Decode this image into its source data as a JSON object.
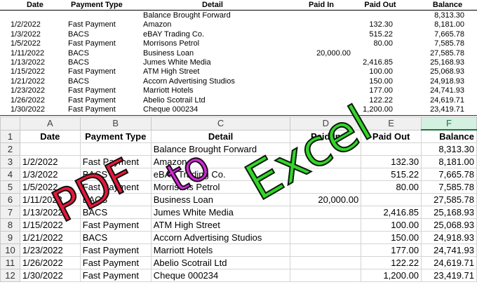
{
  "overlay": {
    "pdf": "PDF",
    "to": "to",
    "excel": "Excel"
  },
  "pdf": {
    "headers": {
      "date": "Date",
      "type": "Payment Type",
      "detail": "Detail",
      "paid_in": "Paid In",
      "paid_out": "Paid Out",
      "balance": "Balance"
    },
    "rows": [
      {
        "date": "",
        "type": "",
        "detail": "Balance Brought Forward",
        "paid_in": "",
        "paid_out": "",
        "balance": "8,313.30"
      },
      {
        "date": "1/2/2022",
        "type": "Fast Payment",
        "detail": "Amazon",
        "paid_in": "",
        "paid_out": "132.30",
        "balance": "8,181.00"
      },
      {
        "date": "1/3/2022",
        "type": "BACS",
        "detail": "eBAY Trading Co.",
        "paid_in": "",
        "paid_out": "515.22",
        "balance": "7,665.78"
      },
      {
        "date": "1/5/2022",
        "type": "Fast Payment",
        "detail": "Morrisons Petrol",
        "paid_in": "",
        "paid_out": "80.00",
        "balance": "7,585.78"
      },
      {
        "date": "1/11/2022",
        "type": "BACS",
        "detail": "Business Loan",
        "paid_in": "20,000.00",
        "paid_out": "",
        "balance": "27,585.78"
      },
      {
        "date": "1/13/2022",
        "type": "BACS",
        "detail": "Jumes White Media",
        "paid_in": "",
        "paid_out": "2,416.85",
        "balance": "25,168.93"
      },
      {
        "date": "1/15/2022",
        "type": "Fast Payment",
        "detail": "ATM High Street",
        "paid_in": "",
        "paid_out": "100.00",
        "balance": "25,068.93"
      },
      {
        "date": "1/21/2022",
        "type": "BACS",
        "detail": "Accorn Advertising Studios",
        "paid_in": "",
        "paid_out": "150.00",
        "balance": "24,918.93"
      },
      {
        "date": "1/23/2022",
        "type": "Fast Payment",
        "detail": "Marriott Hotels",
        "paid_in": "",
        "paid_out": "177.00",
        "balance": "24,741.93"
      },
      {
        "date": "1/26/2022",
        "type": "Fast Payment",
        "detail": "Abelio Scotrail Ltd",
        "paid_in": "",
        "paid_out": "122.22",
        "balance": "24,619.71"
      },
      {
        "date": "1/30/2022",
        "type": "Fast Payment",
        "detail": "Cheque 000234",
        "paid_in": "",
        "paid_out": "1,200.00",
        "balance": "23,419.71"
      }
    ]
  },
  "excel": {
    "column_letters": [
      "A",
      "B",
      "C",
      "D",
      "E",
      "F"
    ],
    "selected_column": "F",
    "headers": [
      "Date",
      "Payment Type",
      "Detail",
      "Paid In",
      "Paid Out",
      "Balance"
    ],
    "rows": [
      {
        "n": "2",
        "date": "",
        "type": "",
        "detail": "Balance Brought Forward",
        "paid_in": "",
        "paid_out": "",
        "balance": "8,313.30"
      },
      {
        "n": "3",
        "date": "1/2/2022",
        "type": "Fast Payment",
        "detail": "Amazon",
        "paid_in": "",
        "paid_out": "132.30",
        "balance": "8,181.00"
      },
      {
        "n": "4",
        "date": "1/3/2022",
        "type": "BACS",
        "detail": "eBAY Trading Co.",
        "paid_in": "",
        "paid_out": "515.22",
        "balance": "7,665.78"
      },
      {
        "n": "5",
        "date": "1/5/2022",
        "type": "Fast Payment",
        "detail": "Morrisons Petrol",
        "paid_in": "",
        "paid_out": "80.00",
        "balance": "7,585.78"
      },
      {
        "n": "6",
        "date": "1/11/2022",
        "type": "BACS",
        "detail": "Business Loan",
        "paid_in": "20,000.00",
        "paid_out": "",
        "balance": "27,585.78"
      },
      {
        "n": "7",
        "date": "1/13/2022",
        "type": "BACS",
        "detail": "Jumes White Media",
        "paid_in": "",
        "paid_out": "2,416.85",
        "balance": "25,168.93"
      },
      {
        "n": "8",
        "date": "1/15/2022",
        "type": "Fast Payment",
        "detail": "ATM High Street",
        "paid_in": "",
        "paid_out": "100.00",
        "balance": "25,068.93"
      },
      {
        "n": "9",
        "date": "1/21/2022",
        "type": "BACS",
        "detail": "Accorn Advertising Studios",
        "paid_in": "",
        "paid_out": "150.00",
        "balance": "24,918.93"
      },
      {
        "n": "10",
        "date": "1/23/2022",
        "type": "Fast Payment",
        "detail": "Marriott Hotels",
        "paid_in": "",
        "paid_out": "177.00",
        "balance": "24,741.93"
      },
      {
        "n": "11",
        "date": "1/26/2022",
        "type": "Fast Payment",
        "detail": "Abelio Scotrail Ltd",
        "paid_in": "",
        "paid_out": "122.22",
        "balance": "24,619.71"
      },
      {
        "n": "12",
        "date": "1/30/2022",
        "type": "Fast Payment",
        "detail": "Cheque 000234",
        "paid_in": "",
        "paid_out": "1,200.00",
        "balance": "23,419.71"
      }
    ]
  },
  "colors": {
    "pdf_red": "#e8173b",
    "to_magenta": "#d42ad9",
    "excel_green": "#35d42a",
    "excel_selected": "#217346"
  }
}
